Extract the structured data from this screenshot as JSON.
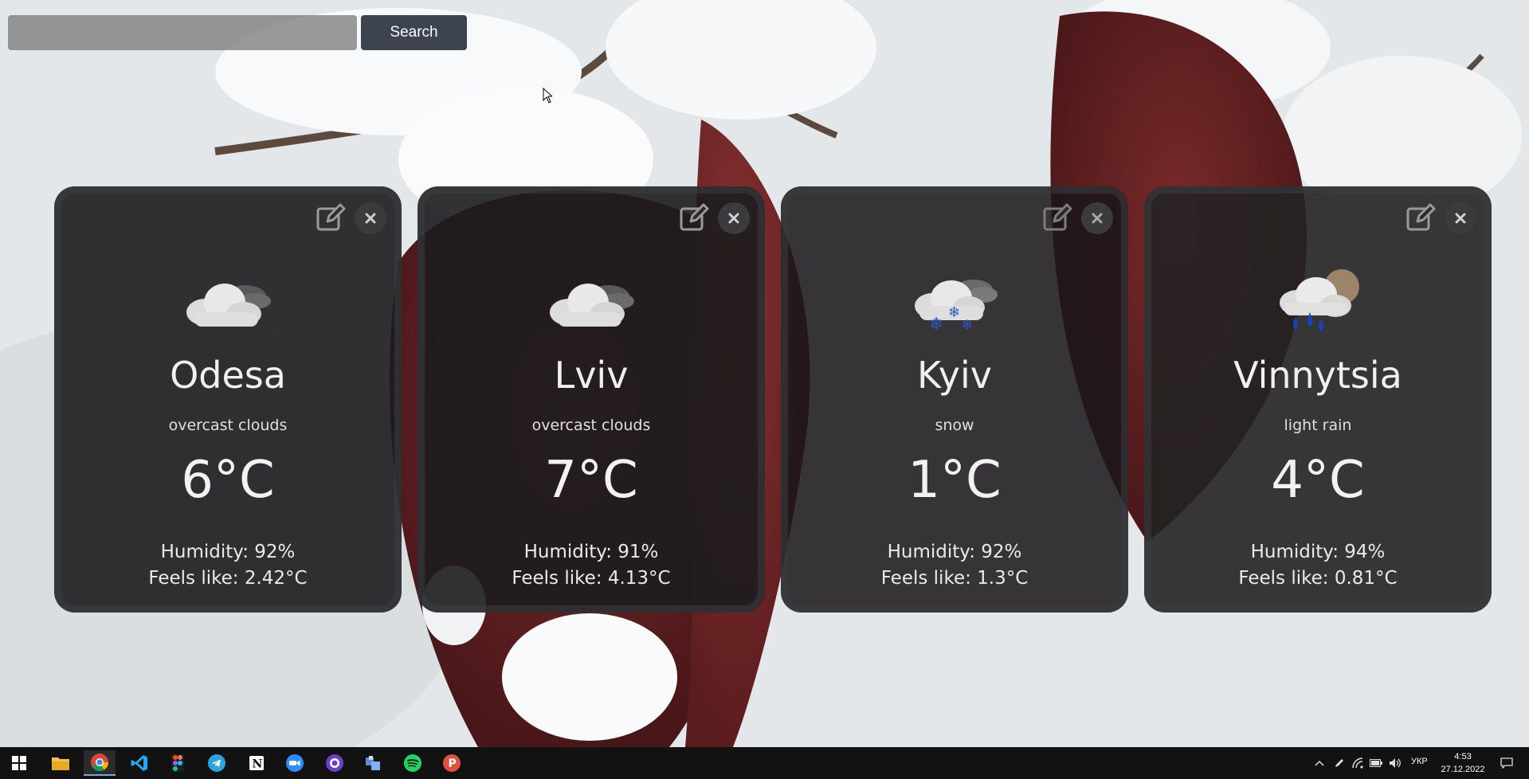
{
  "search": {
    "placeholder": "",
    "value": "",
    "button_label": "Search"
  },
  "cards": [
    {
      "city": "Odesa",
      "description": "overcast clouds",
      "temperature": "6°C",
      "humidity": "Humidity: 92%",
      "feels_like": "Feels like: 2.42°C",
      "icon": "overcast-clouds-icon"
    },
    {
      "city": "Lviv",
      "description": "overcast clouds",
      "temperature": "7°C",
      "humidity": "Humidity: 91%",
      "feels_like": "Feels like: 4.13°C",
      "icon": "overcast-clouds-icon"
    },
    {
      "city": "Kyiv",
      "description": "snow",
      "temperature": "1°C",
      "humidity": "Humidity: 92%",
      "feels_like": "Feels like: 1.3°C",
      "icon": "snow-icon"
    },
    {
      "city": "Vinnytsia",
      "description": "light rain",
      "temperature": "4°C",
      "humidity": "Humidity: 94%",
      "feels_like": "Feels like: 0.81°C",
      "icon": "light-rain-icon"
    }
  ],
  "taskbar": {
    "apps": [
      "start-icon",
      "file-explorer-icon",
      "chrome-icon",
      "vscode-icon",
      "figma-icon",
      "telegram-icon",
      "notion-icon",
      "zoom-icon",
      "github-desktop-icon",
      "app-icon",
      "spotify-icon",
      "postman-icon"
    ],
    "language": "УКР",
    "time": "4:53",
    "date": "27.12.2022"
  },
  "colors": {
    "card_bg": "#1c1c1e",
    "search_button": "#3e4350",
    "taskbar": "#121212"
  }
}
